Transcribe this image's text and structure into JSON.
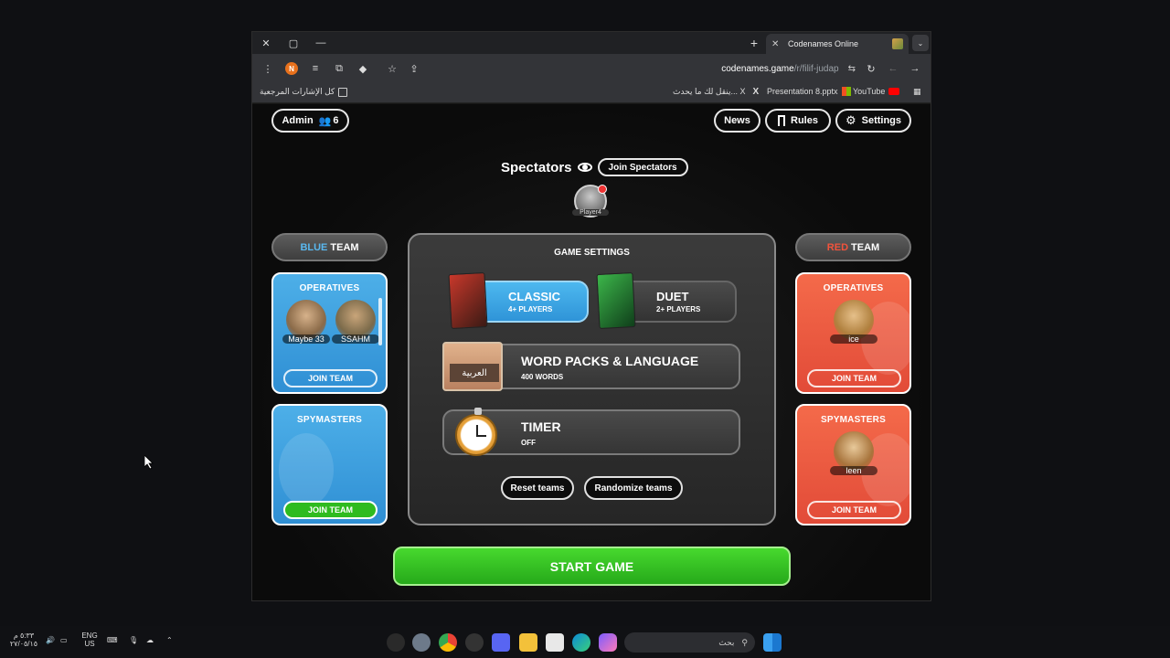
{
  "browser": {
    "tab_title": "Codenames Online",
    "url_host": "codenames.game",
    "url_path": "/r/filif-judap",
    "profile_letter": "N",
    "bookmarks": {
      "all_bookmarks": "كل الإشارات المرجعية",
      "x_post": "ينقل لك ما يحدث... X",
      "presentation": "Presentation 8.pptx",
      "youtube": "YouTube"
    }
  },
  "header": {
    "admin_label": "Admin",
    "player_count": "6",
    "news_label": "News",
    "rules_label": "Rules",
    "settings_label": "Settings"
  },
  "spectators": {
    "title": "Spectators",
    "join_label": "Join Spectators",
    "player_name": "Player4"
  },
  "blue_team": {
    "header_color_word": "BLUE",
    "header_team_word": "TEAM",
    "operatives_title": "OPERATIVES",
    "operatives": [
      "Maybe 33",
      "SSAHM"
    ],
    "operatives_join": "JOIN TEAM",
    "spymasters_title": "SPYMASTERS",
    "spymasters_join": "JOIN TEAM"
  },
  "red_team": {
    "header_color_word": "RED",
    "header_team_word": "TEAM",
    "operatives_title": "OPERATIVES",
    "operatives": [
      "ice"
    ],
    "operatives_join": "JOIN TEAM",
    "spymasters_title": "SPYMASTERS",
    "spymasters": [
      "leen"
    ],
    "spymasters_join": "JOIN TEAM"
  },
  "game_settings": {
    "title": "GAME SETTINGS",
    "classic": {
      "name": "CLASSIC",
      "players": "4+ PLAYERS",
      "selected": true
    },
    "duet": {
      "name": "DUET",
      "players": "2+ PLAYERS",
      "selected": false
    },
    "word_packs": {
      "name": "WORD PACKS & LANGUAGE",
      "sub": "400 WORDS",
      "language_label": "العربية"
    },
    "timer": {
      "name": "TIMER",
      "sub": "OFF"
    },
    "reset_label": "Reset teams",
    "randomize_label": "Randomize teams"
  },
  "start_label": "START GAME",
  "taskbar": {
    "clock_time": "٥:٣٣ م",
    "clock_date": "٢٧/٠٥/١٥",
    "lang_top": "ENG",
    "lang_bottom": "US",
    "search_placeholder": "بحث"
  },
  "colors": {
    "blue": "#4db8ef",
    "red": "#f2533c",
    "green": "#2fbb1f",
    "accent_orange": "#e8711c"
  }
}
